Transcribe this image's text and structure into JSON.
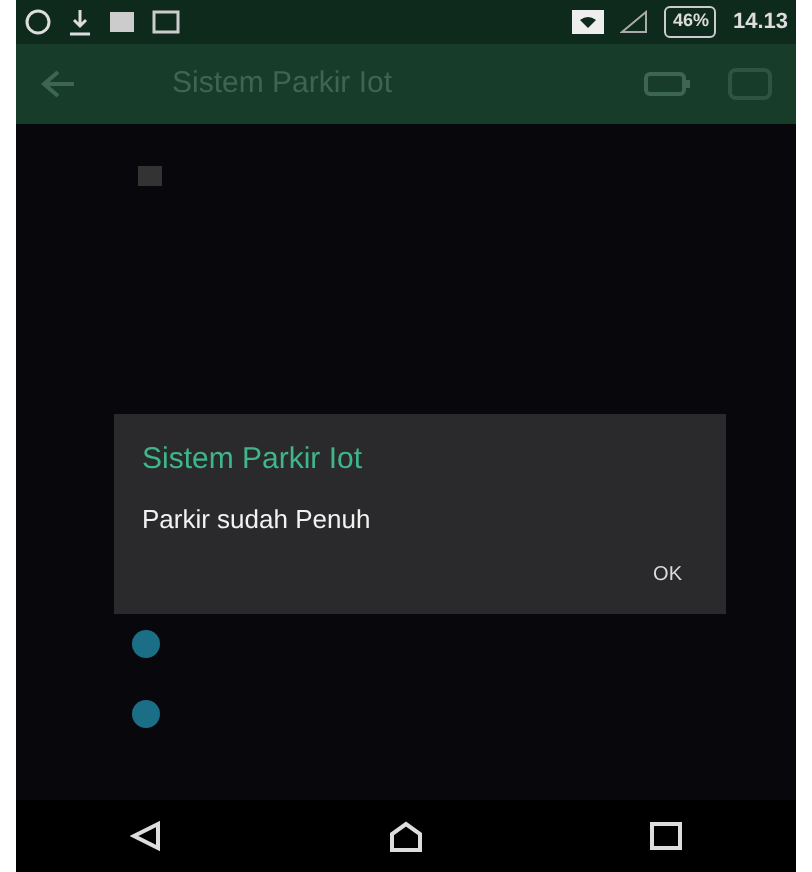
{
  "status_bar": {
    "battery": "46%",
    "time": "14.13"
  },
  "toolbar": {
    "title": "Sistem Parkir Iot"
  },
  "dialog": {
    "title": "Sistem Parkir Iot",
    "message": "Parkir sudah Penuh",
    "buttons": [
      "OK"
    ]
  }
}
